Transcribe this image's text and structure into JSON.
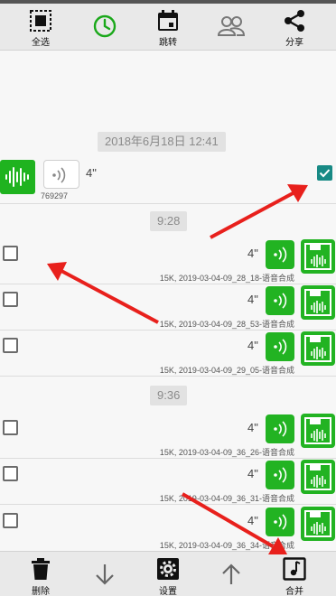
{
  "toolbar": {
    "select_all_label": "全选",
    "jump_label": "跳转",
    "share_label": "分享"
  },
  "first_message": {
    "timestamp": "2018年6月18日 12:41",
    "duration": "4\"",
    "sender_id": "769297",
    "checked": true
  },
  "groups": [
    {
      "time": "9:28",
      "items": [
        {
          "duration": "4\"",
          "filename": "15K, 2019-03-04-09_28_18-语音合成"
        },
        {
          "duration": "4\"",
          "filename": "15K, 2019-03-04-09_28_53-语音合成"
        },
        {
          "duration": "4\"",
          "filename": "15K, 2019-03-04-09_29_05-语音合成"
        }
      ]
    },
    {
      "time": "9:36",
      "items": [
        {
          "duration": "4\"",
          "filename": "15K, 2019-03-04-09_36_26-语音合成"
        },
        {
          "duration": "4\"",
          "filename": "15K, 2019-03-04-09_36_31-语音合成"
        },
        {
          "duration": "4\"",
          "filename": "15K, 2019-03-04-09_36_34-语音合成"
        }
      ]
    }
  ],
  "bottombar": {
    "delete_label": "删除",
    "settings_label": "设置",
    "merge_label": "合并"
  },
  "colors": {
    "accent_green": "#22b322",
    "checkbox_teal": "#188a85",
    "arrow_red": "#e8201c"
  }
}
